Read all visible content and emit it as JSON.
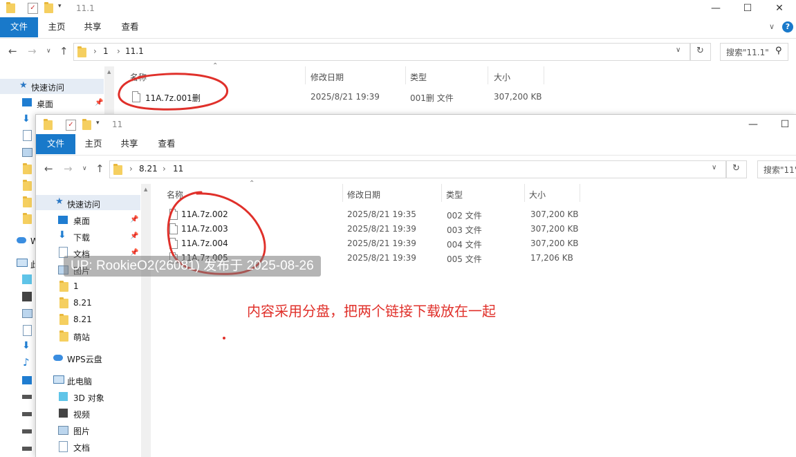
{
  "back_window": {
    "title": "11.1",
    "ribbon_tabs": [
      "文件",
      "主页",
      "共享",
      "查看"
    ],
    "address": [
      "1",
      "11.1"
    ],
    "search_placeholder": "搜索\"11.1\"",
    "columns": [
      "名称",
      "修改日期",
      "类型",
      "大小"
    ],
    "rows": [
      {
        "name": "11A.7z.001删",
        "date": "2025/8/21 19:39",
        "type": "001删 文件",
        "size": "307,200 KB"
      }
    ],
    "nav": {
      "quick_access": "快速访问",
      "desktop": "桌面",
      "wps": "W",
      "pc": "此"
    }
  },
  "front_window": {
    "title": "11",
    "ribbon_tabs": [
      "文件",
      "主页",
      "共享",
      "查看"
    ],
    "address": [
      "8.21",
      "11"
    ],
    "search_placeholder": "搜索\"11\"",
    "columns": [
      "名称",
      "修改日期",
      "类型",
      "大小"
    ],
    "rows": [
      {
        "name": "11A.7z.002",
        "date": "2025/8/21 19:35",
        "type": "002 文件",
        "size": "307,200 KB"
      },
      {
        "name": "11A.7z.003",
        "date": "2025/8/21 19:39",
        "type": "003 文件",
        "size": "307,200 KB"
      },
      {
        "name": "11A.7z.004",
        "date": "2025/8/21 19:39",
        "type": "004 文件",
        "size": "307,200 KB"
      },
      {
        "name": "11A.7z.005",
        "date": "2025/8/21 19:39",
        "type": "005 文件",
        "size": "17,206 KB"
      }
    ],
    "nav": {
      "quick_access": "快速访问",
      "items": [
        "桌面",
        "下载",
        "文档",
        "图片",
        "1",
        "8.21",
        "8.21",
        "萌站"
      ],
      "wps": "WPS云盘",
      "pc": "此电脑",
      "pc_items": [
        "3D 对象",
        "视频",
        "图片",
        "文档"
      ]
    }
  },
  "watermark": "UP: RookieO2(26081) 发布于 2025-08-26",
  "annotation": "内容采用分盘，把两个链接下载放在一起",
  "colors": {
    "accent": "#1979ca",
    "annotation": "#e0302a",
    "selected": "#e5ecf5"
  }
}
